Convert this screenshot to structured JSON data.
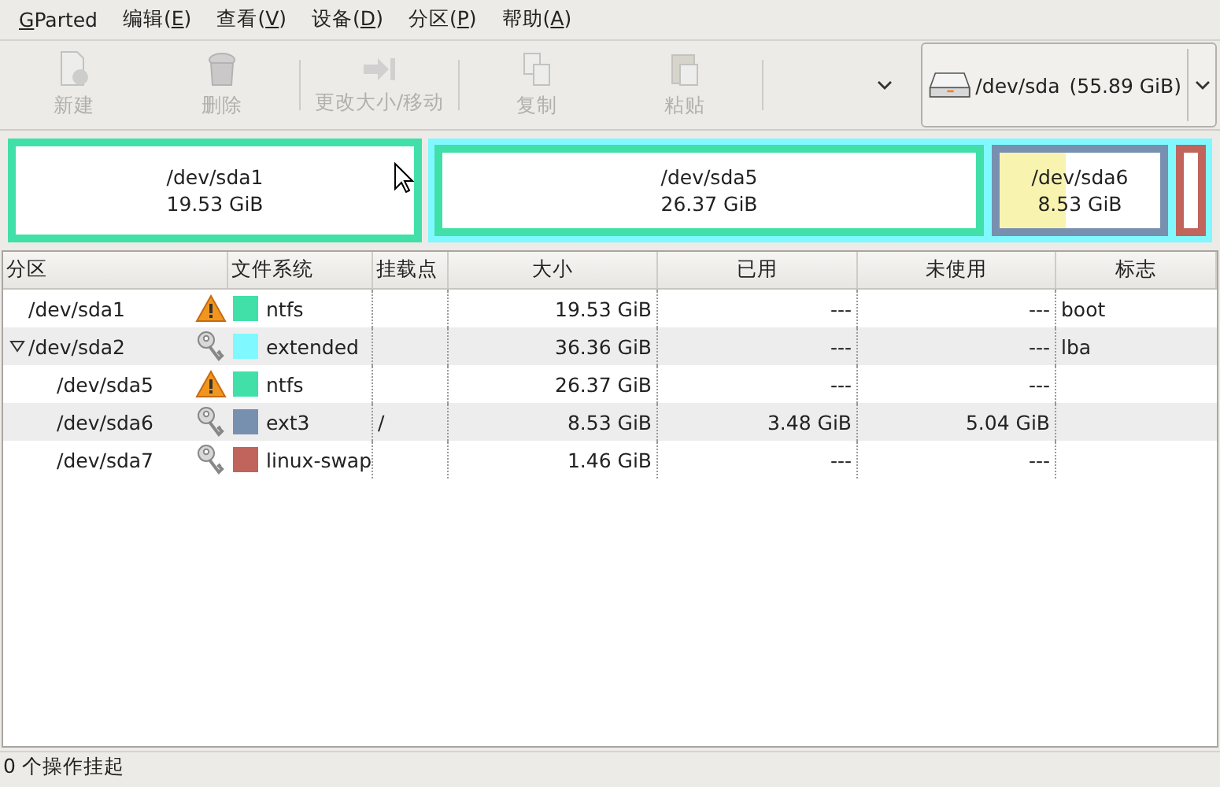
{
  "menu": [
    {
      "key": "G",
      "after": "Parted"
    },
    {
      "before": "编辑(",
      "key": "E",
      "after": ")"
    },
    {
      "before": "查看(",
      "key": "V",
      "after": ")"
    },
    {
      "before": "设备(",
      "key": "D",
      "after": ")"
    },
    {
      "before": "分区(",
      "key": "P",
      "after": ")"
    },
    {
      "before": "帮助(",
      "key": "A",
      "after": ")"
    }
  ],
  "toolbar": [
    {
      "kind": "new",
      "label": "新建",
      "disabled": true
    },
    {
      "kind": "delete",
      "label": "删除",
      "disabled": true
    },
    {
      "kind": "separator"
    },
    {
      "kind": "resize",
      "label": "更改大小/移动",
      "disabled": true
    },
    {
      "kind": "separator"
    },
    {
      "kind": "copy",
      "label": "复制",
      "disabled": true
    },
    {
      "kind": "paste",
      "label": "粘贴",
      "disabled": true
    },
    {
      "kind": "separator"
    },
    {
      "kind": "overflow"
    }
  ],
  "device": {
    "name": "/dev/sda",
    "size": "(55.89 GiB)"
  },
  "disk_map": [
    {
      "kind": "primary",
      "name": "/dev/sda1",
      "size": "19.53 GiB",
      "color": "#40e0a8"
    },
    {
      "kind": "extended",
      "color": "#80f8ff",
      "children": [
        {
          "kind": "primary",
          "name": "/dev/sda5",
          "size": "26.37 GiB",
          "color": "#40e0a8"
        },
        {
          "kind": "primary",
          "name": "/dev/sda6",
          "size": "8.53 GiB",
          "color": "#7890b0",
          "level": 0.41
        },
        {
          "kind": "primary",
          "color": "#c0645c"
        }
      ]
    }
  ],
  "table": {
    "columns": [
      "分区",
      "文件系统",
      "挂载点",
      "大小",
      "已用",
      "未使用",
      "标志"
    ],
    "rows": [
      {
        "partition": "/dev/sda1",
        "kind": "warning",
        "color": "#40e0a8",
        "filesystem": "ntfs",
        "size": "19.53 GiB",
        "used": "---",
        "unused": "---",
        "flags": "boot"
      },
      {
        "partition": "/dev/sda2",
        "kind": "keys",
        "color": "#80f8ff",
        "filesystem": "extended",
        "size": "36.36 GiB",
        "used": "---",
        "unused": "---",
        "flags": "lba",
        "expanded": true,
        "children": [
          {
            "partition": "/dev/sda5",
            "kind": "warning",
            "color": "#40e0a8",
            "filesystem": "ntfs",
            "size": "26.37 GiB",
            "used": "---",
            "unused": "---"
          },
          {
            "partition": "/dev/sda6",
            "kind": "keys",
            "color": "#7890b0",
            "filesystem": "ext3",
            "mount": "/",
            "size": "8.53 GiB",
            "used": "3.48 GiB",
            "unused": "5.04 GiB"
          },
          {
            "partition": "/dev/sda7",
            "kind": "keys",
            "color": "#c0645c",
            "filesystem": "linux-swap",
            "size": "1.46 GiB",
            "used": "---",
            "unused": "---"
          }
        ]
      }
    ]
  },
  "status_bar": "0 个操作挂起"
}
